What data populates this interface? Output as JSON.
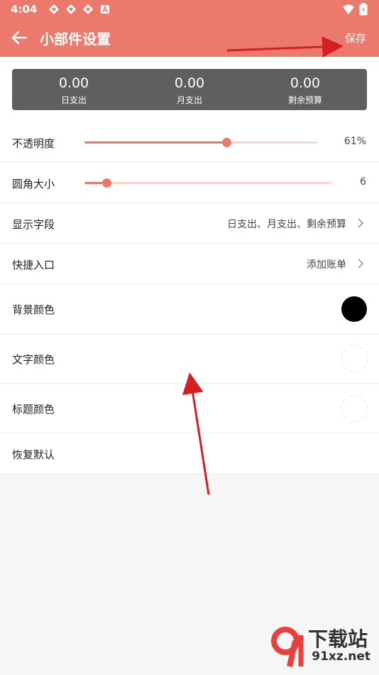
{
  "status_bar": {
    "time": "4:04",
    "icons": [
      "app-notification-icon",
      "app-notification-icon",
      "app-notification-icon",
      "a-badge-icon"
    ],
    "right_icons": [
      "wifi-icon",
      "battery-icon"
    ]
  },
  "toolbar": {
    "title": "小部件设置",
    "save_label": "保存",
    "back_icon": "back-arrow-icon"
  },
  "summary": [
    {
      "value": "0.00",
      "label": "日支出"
    },
    {
      "value": "0.00",
      "label": "月支出"
    },
    {
      "value": "0.00",
      "label": "剩余预算"
    }
  ],
  "settings": {
    "opacity": {
      "label": "不透明度",
      "value": "61%",
      "level": 0.61
    },
    "radius": {
      "label": "圆角大小",
      "value": "6",
      "level": 0.09
    },
    "fields": {
      "label": "显示字段",
      "value": "日支出、月支出、剩余预算"
    },
    "shortcut": {
      "label": "快捷入口",
      "value": "添加账单"
    },
    "bg_color": {
      "label": "背景颜色",
      "color": "#000000"
    },
    "text_color": {
      "label": "文字颜色",
      "color": "#ffffff"
    },
    "title_color": {
      "label": "标题颜色",
      "color": "#ffffff"
    },
    "reset": {
      "label": "恢复默认"
    }
  },
  "colors": {
    "accent": "#ec7a6c",
    "annotation_arrow": "#d42020"
  },
  "watermark": {
    "line1": "下载站",
    "line2": "91xz.net"
  }
}
